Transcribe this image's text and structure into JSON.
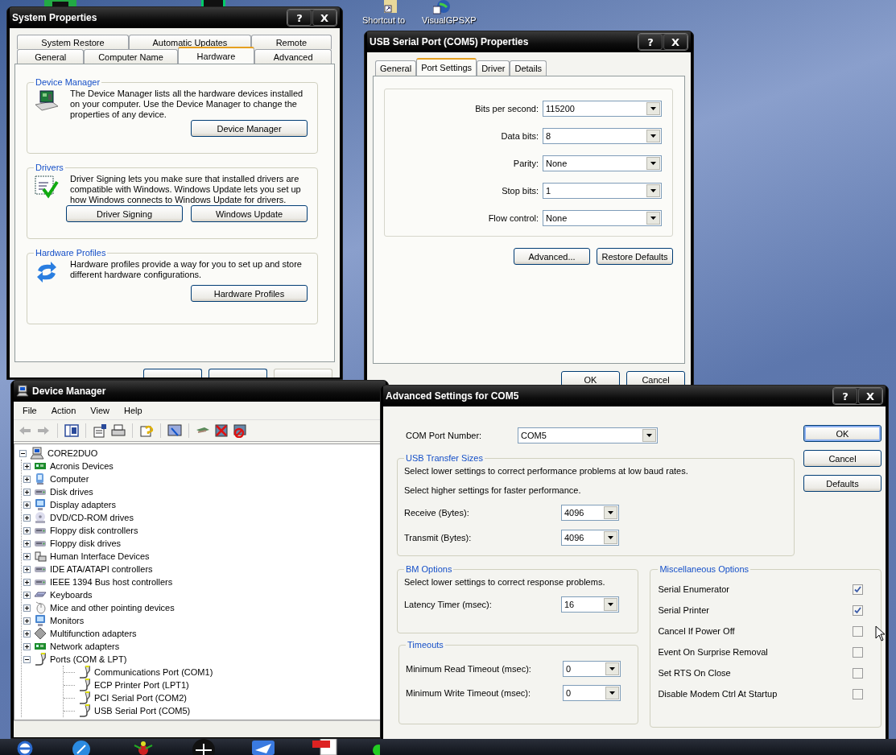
{
  "desktop": {
    "icons": [
      {
        "label": "Shortcut to"
      },
      {
        "label": "VisualGPSXP"
      }
    ]
  },
  "system_properties": {
    "title": "System Properties",
    "title_buttons": [
      "?",
      "X"
    ],
    "tab_rows": [
      [
        {
          "label": "System Restore",
          "selected": false
        },
        {
          "label": "Automatic Updates",
          "selected": false
        },
        {
          "label": "Remote",
          "selected": false
        }
      ],
      [
        {
          "label": "General",
          "selected": false
        },
        {
          "label": "Computer Name",
          "selected": false
        },
        {
          "label": "Hardware",
          "selected": true
        },
        {
          "label": "Advanced",
          "selected": false
        }
      ]
    ],
    "groups": [
      {
        "title": "Device Manager",
        "text": "The Device Manager lists all the hardware devices installed on your computer. Use the Device Manager to change the properties of any device.",
        "buttons": [
          "Device Manager"
        ]
      },
      {
        "title": "Drivers",
        "text": "Driver Signing lets you make sure that installed drivers are compatible with Windows. Windows Update lets you set up how Windows connects to Windows Update for drivers.",
        "buttons": [
          "Driver Signing",
          "Windows Update"
        ]
      },
      {
        "title": "Hardware Profiles",
        "text": "Hardware profiles provide a way for you to set up and store different hardware configurations.",
        "buttons": [
          "Hardware Profiles"
        ]
      }
    ],
    "buttons": [
      {
        "disabled": false
      },
      {
        "disabled": false
      },
      {
        "disabled": true
      }
    ]
  },
  "port_properties": {
    "title": "USB Serial Port (COM5) Properties",
    "title_buttons": [
      "?",
      "X"
    ],
    "tabs": [
      {
        "label": "General",
        "selected": false
      },
      {
        "label": "Port Settings",
        "selected": true
      },
      {
        "label": "Driver",
        "selected": false
      },
      {
        "label": "Details",
        "selected": false
      }
    ],
    "fields": [
      {
        "label": "Bits per second:",
        "value": "115200"
      },
      {
        "label": "Data bits:",
        "value": "8"
      },
      {
        "label": "Parity:",
        "value": "None"
      },
      {
        "label": "Stop bits:",
        "value": "1"
      },
      {
        "label": "Flow control:",
        "value": "None"
      }
    ],
    "panel_buttons": [
      "Advanced...",
      "Restore Defaults"
    ],
    "buttons": [
      "OK",
      "Cancel"
    ]
  },
  "device_manager": {
    "title": "Device Manager",
    "menu": [
      "File",
      "Action",
      "View",
      "Help"
    ],
    "tree": {
      "label": "CORE2DUO",
      "expanded": true,
      "children": [
        {
          "label": "Acronis Devices",
          "expanded": false
        },
        {
          "label": "Computer",
          "expanded": false
        },
        {
          "label": "Disk drives",
          "expanded": false
        },
        {
          "label": "Display adapters",
          "expanded": false
        },
        {
          "label": "DVD/CD-ROM drives",
          "expanded": false
        },
        {
          "label": "Floppy disk controllers",
          "expanded": false
        },
        {
          "label": "Floppy disk drives",
          "expanded": false
        },
        {
          "label": "Human Interface Devices",
          "expanded": false
        },
        {
          "label": "IDE ATA/ATAPI controllers",
          "expanded": false
        },
        {
          "label": "IEEE 1394 Bus host controllers",
          "expanded": false
        },
        {
          "label": "Keyboards",
          "expanded": false
        },
        {
          "label": "Mice and other pointing devices",
          "expanded": false
        },
        {
          "label": "Monitors",
          "expanded": false
        },
        {
          "label": "Multifunction adapters",
          "expanded": false
        },
        {
          "label": "Network adapters",
          "expanded": false
        },
        {
          "label": "Ports (COM & LPT)",
          "expanded": true,
          "children": [
            {
              "label": "Communications Port (COM1)"
            },
            {
              "label": "ECP Printer Port (LPT1)"
            },
            {
              "label": "PCI Serial Port (COM2)"
            },
            {
              "label": "USB Serial Port (COM5)"
            }
          ]
        }
      ]
    }
  },
  "advanced_settings": {
    "title": "Advanced Settings for COM5",
    "title_buttons": [
      "?",
      "X"
    ],
    "com_port": {
      "label": "COM Port Number:",
      "value": "COM5"
    },
    "buttons": [
      {
        "label": "OK",
        "default": true
      },
      {
        "label": "Cancel",
        "default": false
      },
      {
        "label": "Defaults",
        "default": false
      }
    ],
    "usb_transfer": {
      "title": "USB Transfer Sizes",
      "notes": [
        "Select lower settings to correct performance problems at low baud rates.",
        "Select higher settings for faster performance."
      ],
      "fields": [
        {
          "label": "Receive (Bytes):",
          "value": "4096"
        },
        {
          "label": "Transmit (Bytes):",
          "value": "4096"
        }
      ]
    },
    "bm_options": {
      "title": "BM Options",
      "notes": [
        "Select lower settings to correct response problems."
      ],
      "fields": [
        {
          "label": "Latency Timer (msec):",
          "value": "16"
        }
      ]
    },
    "timeouts": {
      "title": "Timeouts",
      "fields": [
        {
          "label": "Minimum Read Timeout (msec):",
          "value": "0"
        },
        {
          "label": "Minimum Write Timeout (msec):",
          "value": "0"
        }
      ]
    },
    "misc": {
      "title": "Miscellaneous Options",
      "options": [
        {
          "label": "Serial Enumerator",
          "checked": true
        },
        {
          "label": "Serial Printer",
          "checked": true
        },
        {
          "label": "Cancel If Power Off",
          "checked": false
        },
        {
          "label": "Event On Surprise Removal",
          "checked": false
        },
        {
          "label": "Set RTS On Close",
          "checked": false
        },
        {
          "label": "Disable Modem Ctrl At Startup",
          "checked": false
        }
      ]
    }
  }
}
